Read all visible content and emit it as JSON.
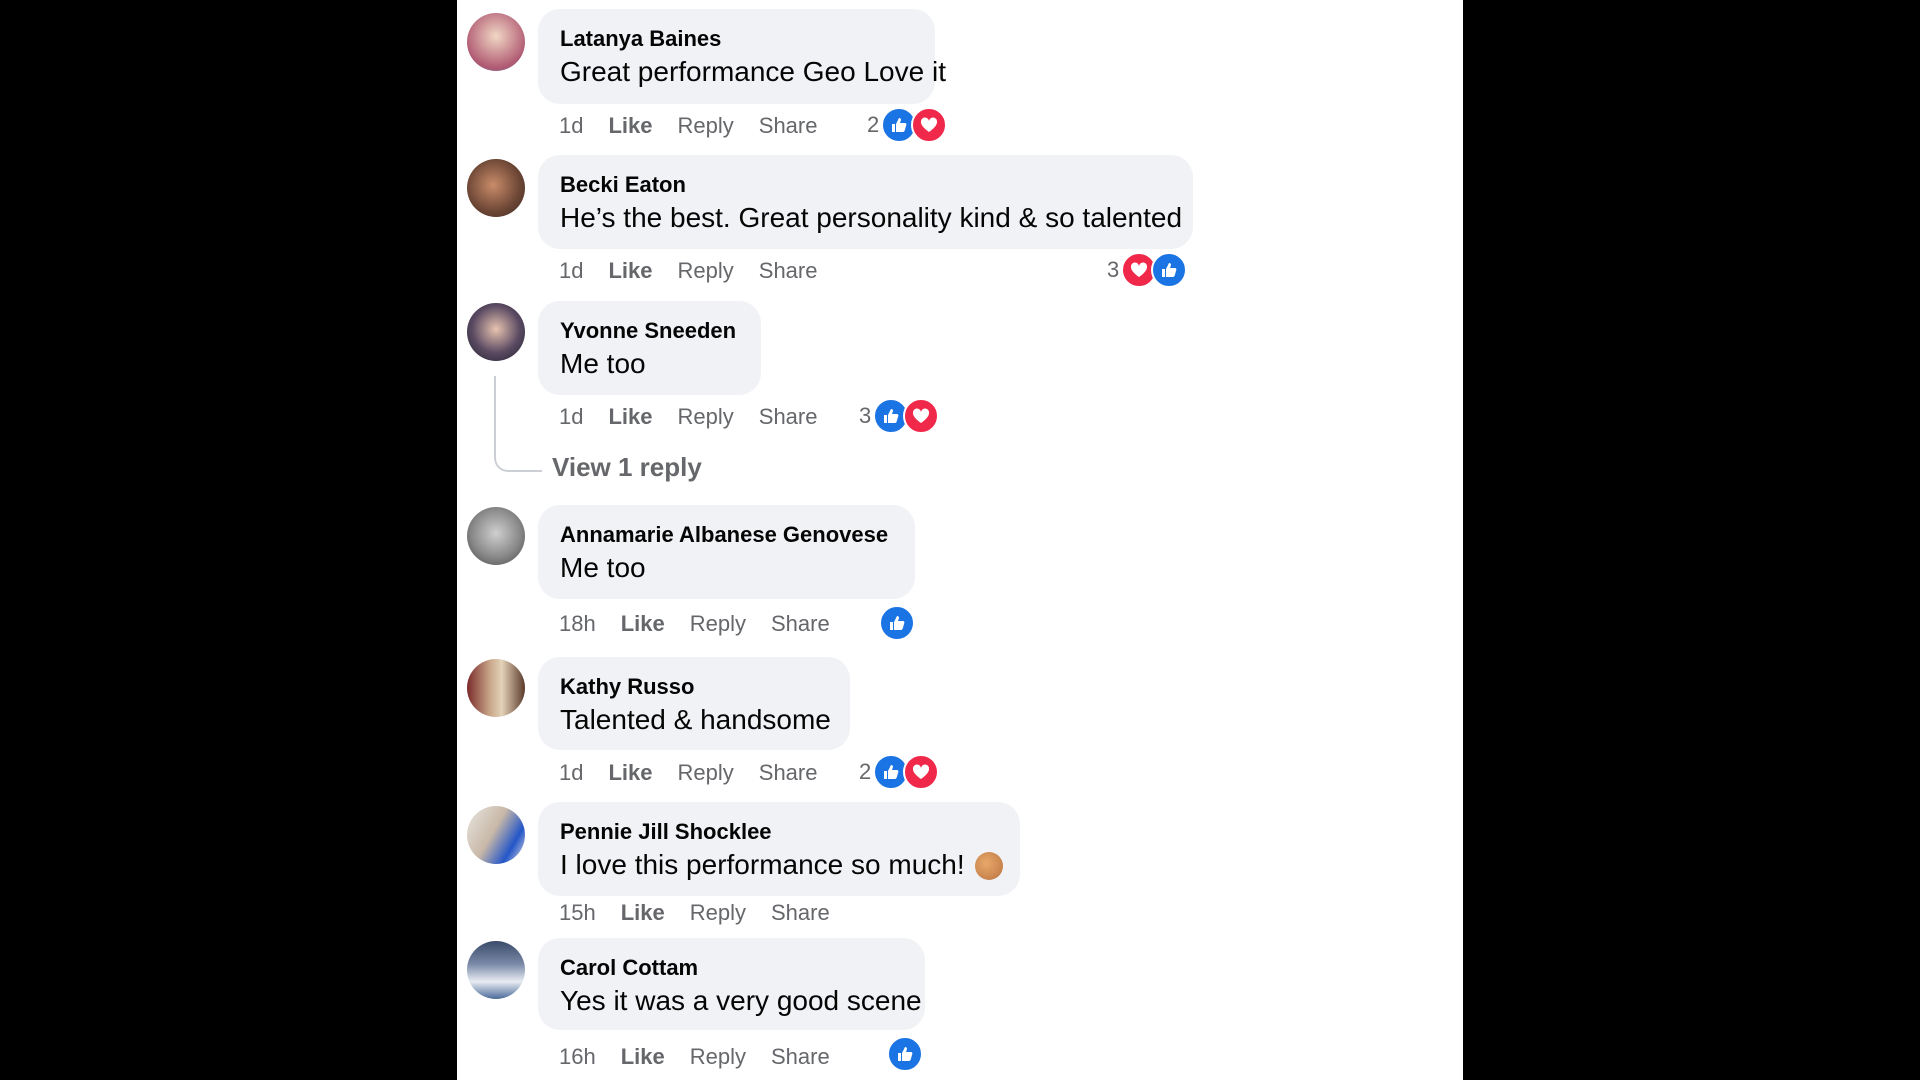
{
  "actions": {
    "like": "Like",
    "reply": "Reply",
    "share": "Share"
  },
  "colors": {
    "like": "#1b74e4",
    "love": "#f02849",
    "bubble": "#f0f2f5",
    "meta": "#65676b"
  },
  "comments": [
    {
      "author": "Latanya Baines",
      "text": "Great performance Geo Love it",
      "time": "1d",
      "reaction_count": "2",
      "reactions": [
        "like",
        "love"
      ]
    },
    {
      "author": "Becki Eaton",
      "text": "He’s the best. Great personality kind & so talented",
      "time": "1d",
      "reaction_count": "3",
      "reactions": [
        "love",
        "like"
      ]
    },
    {
      "author": "Yvonne Sneeden",
      "text": "Me too",
      "time": "1d",
      "reaction_count": "3",
      "reactions": [
        "like",
        "love"
      ],
      "view_replies": "View 1 reply"
    },
    {
      "author": "Annamarie Albanese Genovese",
      "text": "Me too",
      "time": "18h",
      "reaction_count": "",
      "reactions": [
        "like"
      ]
    },
    {
      "author": "Kathy Russo",
      "text": "Talented & handsome",
      "time": "1d",
      "reaction_count": "2",
      "reactions": [
        "like",
        "love"
      ]
    },
    {
      "author": "Pennie Jill Shocklee",
      "text": "I love this performance so much!",
      "emoji": "clapping-hands-emoji",
      "time": "15h",
      "reaction_count": "",
      "reactions": []
    },
    {
      "author": "Carol Cottam",
      "text": "Yes it was a very good scene",
      "time": "16h",
      "reaction_count": "",
      "reactions": [
        "like"
      ]
    }
  ]
}
